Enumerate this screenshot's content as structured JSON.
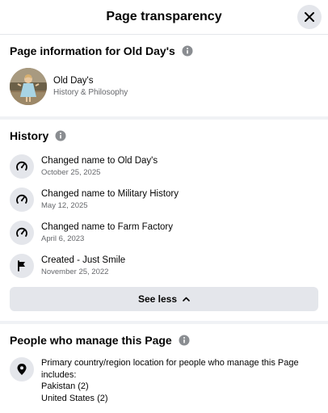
{
  "dialog": {
    "title": "Page transparency"
  },
  "page_info": {
    "heading": "Page information for Old Day's",
    "page_name": "Old Day's",
    "category": "History & Philosophy"
  },
  "history": {
    "heading": "History",
    "items": [
      {
        "title": "Changed name to Old Day's",
        "date": "October 25, 2025",
        "icon": "rename-icon"
      },
      {
        "title": "Changed name to Military History",
        "date": "May 12, 2025",
        "icon": "rename-icon"
      },
      {
        "title": "Changed name to Farm Factory",
        "date": "April 6, 2023",
        "icon": "rename-icon"
      },
      {
        "title": "Created - Just Smile",
        "date": "November 25, 2022",
        "icon": "flag-icon"
      }
    ],
    "see_less_label": "See less"
  },
  "managers": {
    "heading": "People who manage this Page",
    "description": "Primary country/region location for people who manage this Page includes:",
    "locations": [
      "Pakistan (2)",
      "United States (2)"
    ]
  },
  "colors": {
    "text": "#050505",
    "secondary_text": "#65676b",
    "icon_bg": "#e4e6eb",
    "divider": "#f0f2f5"
  }
}
